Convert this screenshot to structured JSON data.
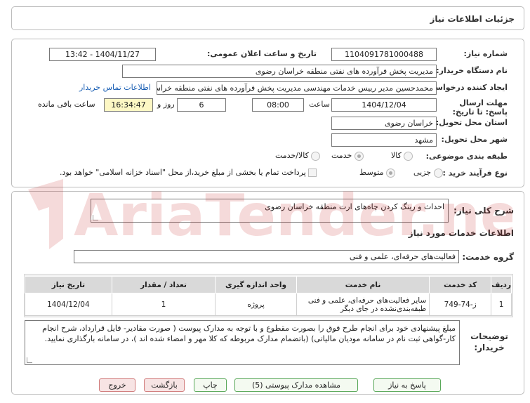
{
  "header": {
    "title": "جزئیات اطلاعات نیاز"
  },
  "fields": {
    "need_number_label": "شماره نیاز:",
    "need_number": "1104091781000488",
    "announce_label": "تاریخ و ساعت اعلان عمومی:",
    "announce_value": "1404/11/27 - 13:42",
    "buyer_org_label": "نام دستگاه خریدار:",
    "buyer_org": "مدیریت پخش فرآورده های نفتی منطقه خراسان رضوی",
    "creator_label": "ایجاد کننده درخواست:",
    "creator": "محمدحسین مدیر رییس خدمات مهندسی مدیریت پخش فرآورده های نفتی منطقه خراسان رضوی",
    "contact_link": "اطلاعات تماس خریدار",
    "deadline_label": "مهلت ارسال پاسخ: تا تاریخ:",
    "deadline_date": "1404/12/04",
    "time_label": "ساعت",
    "deadline_time": "08:00",
    "days": "6",
    "days_label": "روز و",
    "remaining_time": "16:34:47",
    "remaining_label": "ساعت باقی مانده",
    "province_label": "استان محل تحویل:",
    "province": "خراسان رضوی",
    "city_label": "شهر محل تحویل:",
    "city": "مشهد",
    "category_label": "طبقه بندی موضوعی:",
    "category_options": [
      "کالا",
      "خدمت",
      "کالا/خدمت"
    ],
    "category_selected": "خدمت",
    "process_label": "نوع فرآیند خرید :",
    "process_options": [
      "جزیی",
      "متوسط"
    ],
    "process_selected": "متوسط",
    "payment_note": "پرداخت تمام یا بخشی از مبلغ خرید،از محل \"اسناد خزانه اسلامی\" خواهد بود."
  },
  "summary": {
    "label": "شرح کلی نیاز:",
    "value": "احداث و رینگ کردن چاه‌های ارت منطقه خراسان رضوی"
  },
  "services": {
    "section_title": "اطلاعات خدمات مورد نیاز",
    "group_label": "گروه خدمت:",
    "group_value": "فعالیت‌های حرفه‌ای، علمی و فنی",
    "columns": [
      "ردیف",
      "کد خدمت",
      "نام خدمت",
      "واحد اندازه گیری",
      "تعداد / مقدار",
      "تاریخ نیاز"
    ],
    "rows": [
      {
        "row": "1",
        "code": "ز-74-749",
        "name": "سایر فعالیت‌های حرفه‌ای، علمی و فنی طبقه‌بندی‌نشده در جای دیگر",
        "unit": "پروژه",
        "qty": "1",
        "date": "1404/12/04"
      }
    ]
  },
  "buyer_notes": {
    "label": "توضیحات خریدار:",
    "value": "مبلغ پیشنهادی خود برای انجام طرح فوق را بصورت مقطوع و با توجه به مدارک پیوست ( صورت مقادیر- فایل قرارداد، شرح انجام کار-گواهی ثبت نام در سامانه مودیان مالیاتی) (باتضمام مدارک مربوطه که کلا مهر و امضاء شده اند )، در سامانه بارگذاری نمایید."
  },
  "buttons": {
    "reply": "پاسخ به نیاز",
    "docs": "مشاهده مدارک پیوستی (5)",
    "print": "چاپ",
    "back": "بازگشت",
    "exit": "خروج"
  },
  "watermark": {
    "text": "AriaTender.net"
  }
}
